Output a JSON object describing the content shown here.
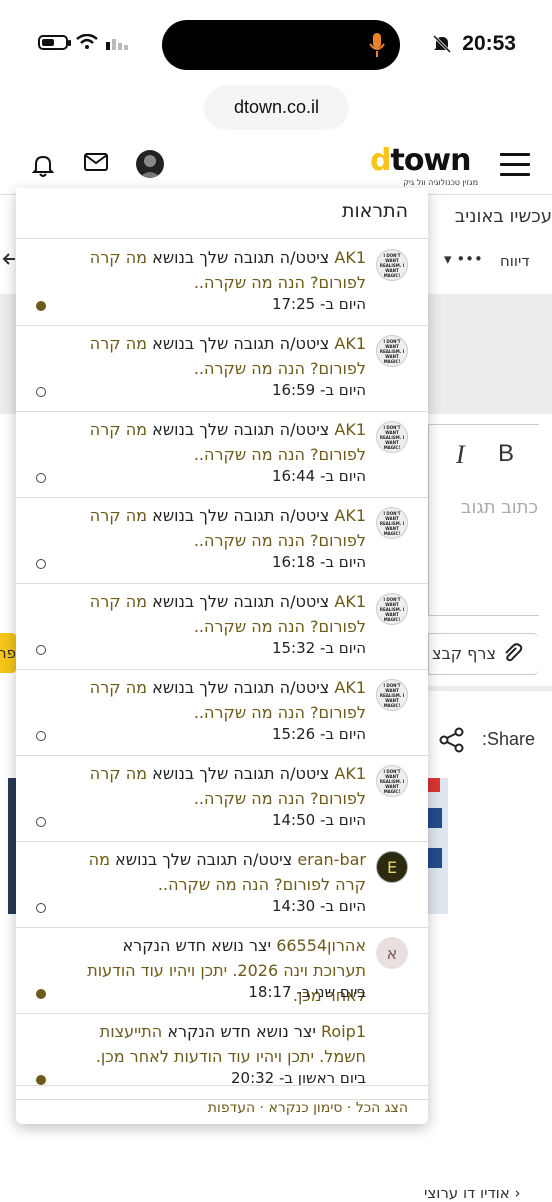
{
  "status_bar": {
    "time": "20:53"
  },
  "browser": {
    "url": "dtown.co.il"
  },
  "header": {
    "logo_d": "d",
    "logo_rest": "town",
    "logo_tagline": "מגזין טכנולוגיה וול גיק"
  },
  "background": {
    "headline": "עכשיו באוניב",
    "report": "דיווח",
    "more": "•••",
    "write_reply": "כתוב תגוב",
    "attach": "צרף קבצ",
    "share": "Share:",
    "yellow_btn": "פר",
    "bottom_link": "אודיו דו ערוצי",
    "bold_btn": "B",
    "italic_btn": "I"
  },
  "notifications": {
    "title": "התראות",
    "items": [
      {
        "user": "AK1",
        "action": " ציטט/ה תגובה שלך בנושא ",
        "topic": "מה קרה לפורום? הנה מה שקרה..",
        "when": "היום ב- 17:25",
        "read": false,
        "avatar": "image"
      },
      {
        "user": "AK1",
        "action": " ציטט/ה תגובה שלך בנושא ",
        "topic": "מה קרה לפורום? הנה מה שקרה..",
        "when": "היום ב- 16:59",
        "read": true,
        "avatar": "image"
      },
      {
        "user": "AK1",
        "action": " ציטט/ה תגובה שלך בנושא ",
        "topic": "מה קרה לפורום? הנה מה שקרה..",
        "when": "היום ב- 16:44",
        "read": true,
        "avatar": "image"
      },
      {
        "user": "AK1",
        "action": " ציטט/ה תגובה שלך בנושא ",
        "topic": "מה קרה לפורום? הנה מה שקרה..",
        "when": "היום ב- 16:18",
        "read": true,
        "avatar": "image"
      },
      {
        "user": "AK1",
        "action": " ציטט/ה תגובה שלך בנושא ",
        "topic": "מה קרה לפורום? הנה מה שקרה..",
        "when": "היום ב- 15:32",
        "read": true,
        "avatar": "image"
      },
      {
        "user": "AK1",
        "action": " ציטט/ה תגובה שלך בנושא ",
        "topic": "מה קרה לפורום? הנה מה שקרה..",
        "when": "היום ב- 15:26",
        "read": true,
        "avatar": "image"
      },
      {
        "user": "AK1",
        "action": " ציטט/ה תגובה שלך בנושא ",
        "topic": "מה קרה לפורום? הנה מה שקרה..",
        "when": "היום ב- 14:50",
        "read": true,
        "avatar": "image"
      },
      {
        "user": "eran-bar",
        "action": " ציטט/ה תגובה שלך בנושא ",
        "topic": "מה קרה לפורום? הנה מה שקרה..",
        "when": "היום ב- 14:30",
        "read": true,
        "avatar": "E"
      },
      {
        "user": "אהרון66554",
        "action": " יצר נושא חדש הנקרא ",
        "topic": "תערוכת וינה 2026. יתכן ויהיו עוד הודעות לאחר מכן.",
        "when": "ביום שני ב- 18:17",
        "read": false,
        "avatar": "א"
      },
      {
        "user": "Roip1",
        "action": " יצר נושא חדש הנקרא ",
        "topic": "התייעצות חשמל. יתכן ויהיו עוד הודעות לאחר מכן.",
        "when": "ביום ראשון ב- 20:32",
        "read": false,
        "avatar": "none"
      }
    ],
    "avatar_caption": "I DON'T WANT REALISM. I WANT MAGIC!",
    "footer": "הצג הכל · סימון כנקרא · העדפות"
  },
  "colors": {
    "accent": "#f5c518",
    "link": "#6b5a1a"
  }
}
